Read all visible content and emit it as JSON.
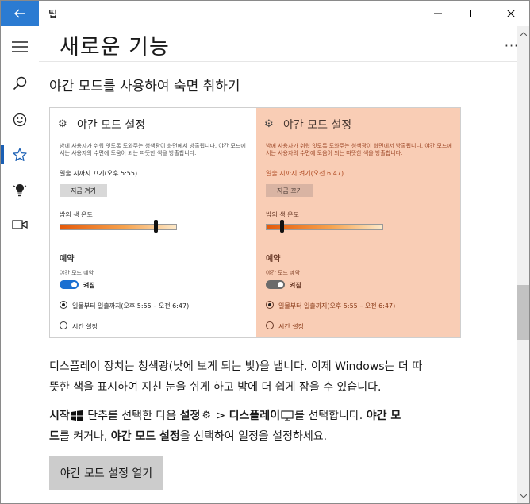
{
  "window": {
    "app_title": "팁",
    "controls": {
      "minimize": "minimize",
      "maximize": "maximize",
      "close": "close"
    },
    "accent_color": "#2b7bd2"
  },
  "nav": {
    "items": [
      {
        "icon": "hamburger-menu-icon"
      },
      {
        "icon": "search-icon"
      },
      {
        "icon": "smiley-icon"
      },
      {
        "icon": "star-icon",
        "selected": true
      },
      {
        "icon": "lightbulb-icon"
      },
      {
        "icon": "video-camera-icon"
      }
    ]
  },
  "header": {
    "title": "새로운 기능",
    "more": "···"
  },
  "article": {
    "title": "야간 모드를 사용하여 숙면 취하기",
    "illustration": {
      "left_panel": {
        "title": "야간 모드 설정",
        "desc": "밤에 사용자가 쉬워 잇도록 도와주는 청색광이 화면에서 방출됩니다. 야간 모드에서는 사용자의 수면에 도움이 되는 따뜻한 색을 방출합니다.",
        "until": "일출 시까지 끄기(오후 5:55)",
        "button": "지금 켜기",
        "color_label": "밤의 색 온도",
        "slider_value": 0.9,
        "schedule_heading": "예약",
        "schedule_label": "야간 모드 예약",
        "toggle_text": "켜짐",
        "radio1": "일몰부터 일출까지(오후 5:55 – 오전 6:47)",
        "radio2": "시간 설정"
      },
      "right_panel": {
        "title": "야간 모드 설정",
        "desc": "밤에 사용자가 쉬워 잇도록 도와주는 청색광이 화면에서 방출됩니다. 야간 모드에서는 사용자의 수면에 도움이 되는 따뜻한 색을 방출합니다.",
        "until": "일출 시까지 켜기(오전 6:47)",
        "button": "지금 끄기",
        "color_label": "밤의 색 온도",
        "slider_value": 0.18,
        "schedule_heading": "예약",
        "schedule_label": "야간 모드 예약",
        "toggle_text": "켜짐",
        "radio1": "일몰부터 일출까지(오후 5:55 – 오전 6:47)",
        "radio2": "시간 설정"
      }
    },
    "para1_line1": "디스플레이 장치는 청색광(낮에 보게 되는 빛)을 냅니다. 이제 Windows는 더 따",
    "para1_line2": "뜻한 색을 표시하여 지친 눈을 쉬게 하고 밤에 더 쉽게 잠을 수 있습니다.",
    "para2": {
      "start": "시작",
      "t1": " 단추를 선택한 다음 ",
      "settings": "설정",
      "t2": " > ",
      "display": "디스플레이",
      "t3": "를 선택합니다. ",
      "nightmode": "야간 모",
      "line2_a": "드",
      "line2_b": "를 켜거나, ",
      "nightmode_settings": "야간 모드 설정",
      "line2_c": "을 선택하여 일정을 설정하세요."
    },
    "open_button": "야간 모드 설정 열기"
  }
}
